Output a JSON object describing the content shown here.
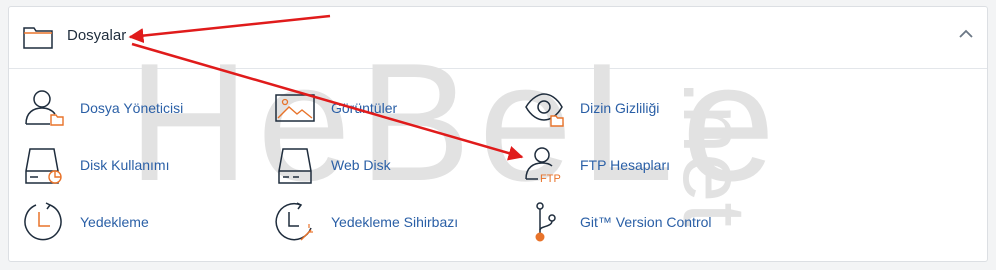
{
  "section": {
    "title": "Dosyalar",
    "icon": "folder-icon",
    "collapse_icon": "chevron-up-icon"
  },
  "watermark": {
    "text": "HeBeLe",
    "suffix": ".net"
  },
  "items": [
    {
      "label": "Dosya Yöneticisi",
      "icon": "file-manager-icon"
    },
    {
      "label": "Görüntüler",
      "icon": "images-icon"
    },
    {
      "label": "Dizin Gizliliği",
      "icon": "directory-privacy-icon"
    },
    {
      "label": "Disk Kullanımı",
      "icon": "disk-usage-icon"
    },
    {
      "label": "Web Disk",
      "icon": "web-disk-icon"
    },
    {
      "label": "FTP Hesapları",
      "icon": "ftp-accounts-icon",
      "badge": "FTP"
    },
    {
      "label": "Yedekleme",
      "icon": "backup-icon"
    },
    {
      "label": "Yedekleme Sihirbazı",
      "icon": "backup-wizard-icon"
    },
    {
      "label": "Git™ Version Control",
      "icon": "git-icon"
    }
  ],
  "colors": {
    "link": "#2a5fa6",
    "icon_stroke": "#1f2d3d",
    "accent": "#e8732a",
    "annotation_arrow": "#e01b1b"
  }
}
